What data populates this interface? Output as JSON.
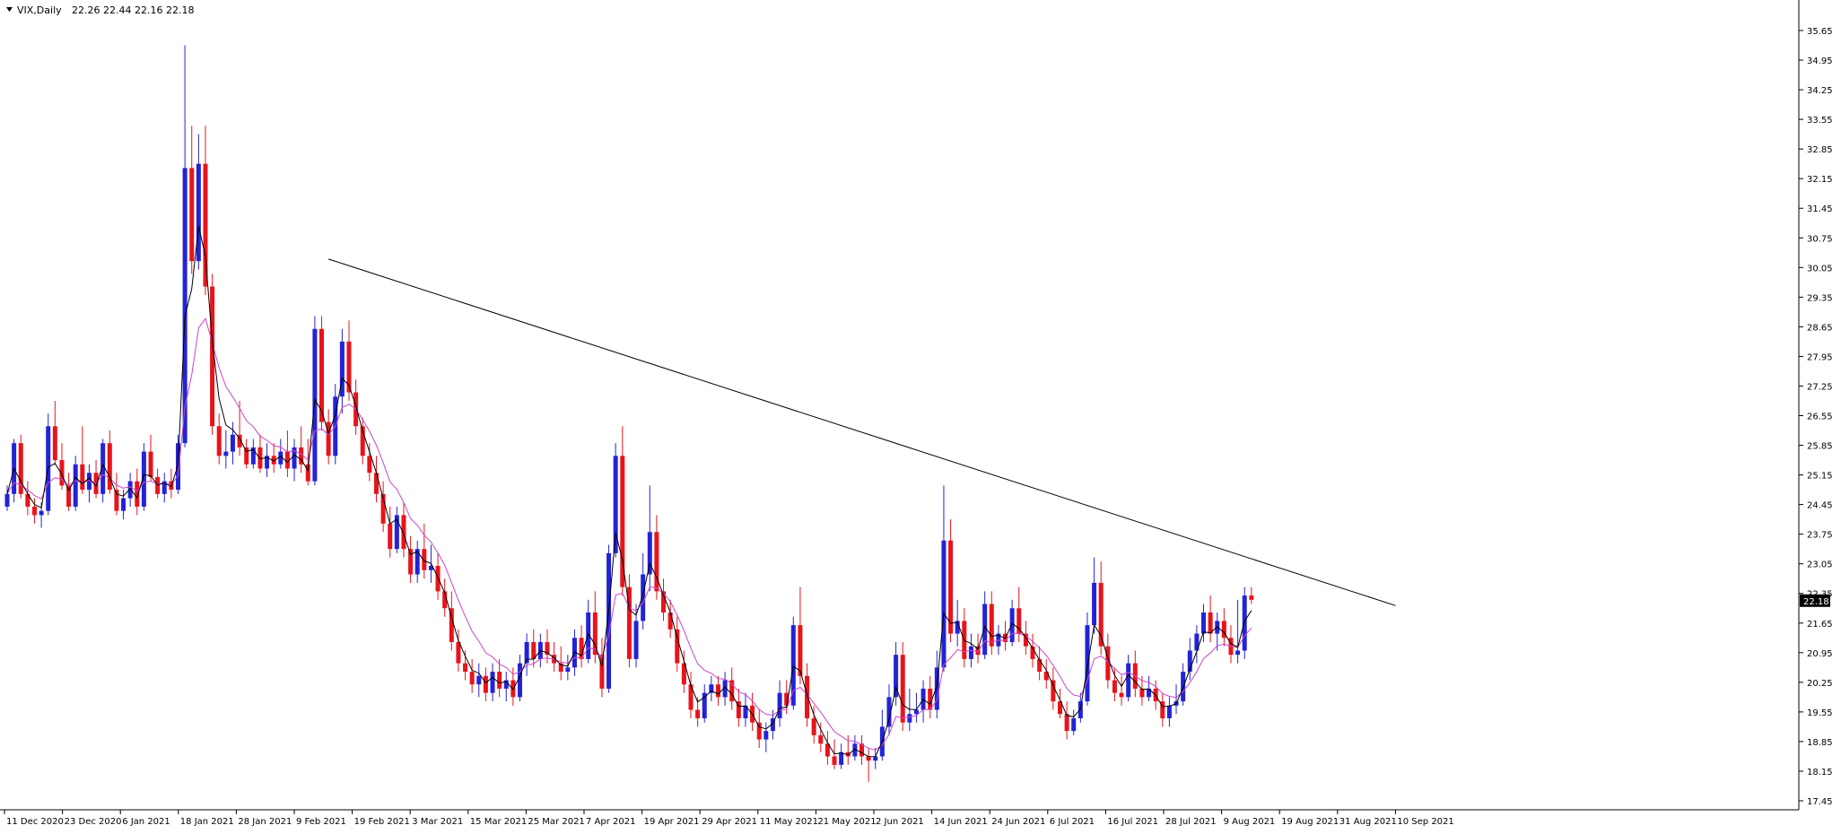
{
  "header": {
    "symbol_label": "VIX,Daily",
    "ohlc_readout": "22.26 22.44 22.16 22.18"
  },
  "colors": {
    "bull": "#2323d6",
    "bear": "#e8141b",
    "ma_fast": "#000000",
    "ma_slow": "#cc44cc",
    "trendline": "#000000",
    "axis": "#000000"
  },
  "chart_data": {
    "type": "candlestick",
    "x_tick_labels": [
      "11 Dec 2020",
      "23 Dec 2020",
      "6 Jan 2021",
      "18 Jan 2021",
      "28 Jan 2021",
      "9 Feb 2021",
      "19 Feb 2021",
      "3 Mar 2021",
      "15 Mar 2021",
      "25 Mar 2021",
      "7 Apr 2021",
      "19 Apr 2021",
      "29 Apr 2021",
      "11 May 2021",
      "21 May 2021",
      "2 Jun 2021",
      "14 Jun 2021",
      "24 Jun 2021",
      "6 Jul 2021",
      "16 Jul 2021",
      "28 Jul 2021",
      "9 Aug 2021",
      "19 Aug 2021",
      "31 Aug 2021",
      "10 Sep 2021"
    ],
    "y_tick_labels": [
      "35.65",
      "34.95",
      "34.25",
      "33.55",
      "32.85",
      "32.15",
      "31.45",
      "30.75",
      "30.05",
      "29.35",
      "28.65",
      "27.95",
      "27.25",
      "26.55",
      "25.85",
      "25.15",
      "24.45",
      "23.75",
      "23.05",
      "22.35",
      "21.65",
      "20.95",
      "20.25",
      "19.55",
      "18.85",
      "18.15",
      "17.45"
    ],
    "ylim": [
      17.45,
      35.65
    ],
    "current_price_label": "22.18",
    "candles": [
      [
        24.4,
        24.9,
        24.3,
        24.7
      ],
      [
        24.7,
        26.0,
        24.5,
        25.9
      ],
      [
        25.9,
        26.1,
        24.6,
        24.7
      ],
      [
        24.7,
        25.0,
        24.2,
        24.4
      ],
      [
        24.4,
        24.6,
        24.0,
        24.2
      ],
      [
        24.2,
        24.5,
        23.9,
        24.3
      ],
      [
        24.3,
        26.6,
        24.2,
        26.3
      ],
      [
        26.3,
        26.9,
        25.4,
        25.5
      ],
      [
        25.5,
        25.9,
        24.8,
        24.9
      ],
      [
        24.9,
        25.2,
        24.3,
        24.4
      ],
      [
        24.4,
        25.6,
        24.3,
        25.4
      ],
      [
        25.4,
        26.3,
        24.7,
        24.8
      ],
      [
        24.8,
        25.4,
        24.5,
        25.2
      ],
      [
        25.2,
        25.5,
        24.6,
        24.7
      ],
      [
        24.7,
        26.0,
        24.5,
        25.9
      ],
      [
        25.9,
        26.2,
        24.7,
        24.8
      ],
      [
        24.8,
        25.2,
        24.2,
        24.3
      ],
      [
        24.3,
        24.8,
        24.1,
        24.6
      ],
      [
        24.6,
        25.2,
        24.4,
        25.0
      ],
      [
        25.0,
        25.3,
        24.2,
        24.4
      ],
      [
        24.4,
        25.9,
        24.3,
        25.7
      ],
      [
        25.7,
        26.1,
        25.0,
        25.1
      ],
      [
        25.1,
        25.3,
        24.6,
        24.7
      ],
      [
        24.7,
        25.2,
        24.5,
        25.0
      ],
      [
        25.0,
        25.3,
        24.6,
        24.8
      ],
      [
        24.8,
        26.1,
        24.7,
        25.9
      ],
      [
        25.9,
        35.3,
        25.8,
        32.4
      ],
      [
        32.4,
        33.4,
        29.9,
        30.2
      ],
      [
        30.2,
        33.2,
        30.0,
        32.5
      ],
      [
        32.5,
        33.4,
        29.4,
        29.6
      ],
      [
        29.6,
        29.9,
        26.1,
        26.3
      ],
      [
        26.3,
        26.6,
        25.4,
        25.6
      ],
      [
        25.6,
        26.2,
        25.3,
        25.7
      ],
      [
        25.7,
        26.4,
        25.4,
        26.1
      ],
      [
        26.1,
        26.9,
        25.6,
        25.8
      ],
      [
        25.8,
        26.0,
        25.3,
        25.4
      ],
      [
        25.4,
        26.0,
        25.3,
        25.8
      ],
      [
        25.8,
        26.1,
        25.2,
        25.3
      ],
      [
        25.3,
        25.9,
        25.1,
        25.6
      ],
      [
        25.6,
        25.9,
        25.2,
        25.4
      ],
      [
        25.4,
        26.0,
        25.3,
        25.7
      ],
      [
        25.7,
        26.2,
        25.1,
        25.3
      ],
      [
        25.3,
        26.0,
        25.0,
        25.8
      ],
      [
        25.8,
        26.3,
        25.2,
        25.4
      ],
      [
        25.4,
        26.0,
        24.9,
        25.0
      ],
      [
        25.0,
        28.9,
        24.9,
        28.6
      ],
      [
        28.6,
        28.9,
        26.2,
        26.4
      ],
      [
        26.4,
        26.7,
        25.4,
        25.6
      ],
      [
        25.6,
        27.3,
        25.4,
        27.0
      ],
      [
        27.0,
        28.6,
        26.6,
        28.3
      ],
      [
        28.3,
        28.8,
        26.9,
        27.1
      ],
      [
        27.1,
        27.4,
        26.1,
        26.3
      ],
      [
        26.3,
        26.5,
        25.4,
        25.6
      ],
      [
        25.6,
        25.9,
        25.0,
        25.2
      ],
      [
        25.2,
        25.6,
        24.5,
        24.7
      ],
      [
        24.7,
        25.0,
        23.8,
        24.0
      ],
      [
        24.0,
        24.4,
        23.2,
        23.4
      ],
      [
        23.4,
        24.4,
        23.3,
        24.2
      ],
      [
        24.2,
        24.5,
        23.2,
        23.4
      ],
      [
        23.4,
        23.7,
        22.6,
        22.8
      ],
      [
        22.8,
        23.6,
        22.6,
        23.4
      ],
      [
        23.4,
        24.0,
        22.7,
        22.9
      ],
      [
        22.9,
        23.5,
        22.6,
        23.0
      ],
      [
        23.0,
        23.3,
        22.2,
        22.4
      ],
      [
        22.4,
        22.7,
        21.8,
        22.0
      ],
      [
        22.0,
        22.4,
        21.0,
        21.2
      ],
      [
        21.2,
        21.5,
        20.5,
        20.7
      ],
      [
        20.7,
        21.0,
        20.3,
        20.5
      ],
      [
        20.5,
        20.8,
        20.0,
        20.2
      ],
      [
        20.2,
        20.7,
        19.9,
        20.4
      ],
      [
        20.4,
        20.6,
        19.8,
        20.0
      ],
      [
        20.0,
        20.7,
        19.8,
        20.5
      ],
      [
        20.5,
        20.8,
        19.9,
        20.1
      ],
      [
        20.1,
        20.5,
        19.8,
        20.3
      ],
      [
        20.3,
        20.6,
        19.7,
        19.9
      ],
      [
        19.9,
        20.9,
        19.8,
        20.7
      ],
      [
        20.7,
        21.4,
        20.4,
        21.2
      ],
      [
        21.2,
        21.5,
        20.6,
        20.8
      ],
      [
        20.8,
        21.4,
        20.6,
        21.2
      ],
      [
        21.2,
        21.5,
        20.7,
        20.9
      ],
      [
        20.9,
        21.2,
        20.5,
        20.7
      ],
      [
        20.7,
        21.1,
        20.3,
        20.5
      ],
      [
        20.5,
        20.9,
        20.3,
        20.6
      ],
      [
        20.6,
        21.5,
        20.4,
        21.3
      ],
      [
        21.3,
        21.6,
        20.6,
        20.8
      ],
      [
        20.8,
        22.2,
        20.7,
        21.9
      ],
      [
        21.9,
        22.4,
        20.7,
        20.9
      ],
      [
        20.9,
        21.3,
        19.9,
        20.1
      ],
      [
        20.1,
        23.5,
        20.0,
        23.3
      ],
      [
        23.3,
        25.9,
        23.2,
        25.6
      ],
      [
        25.6,
        26.3,
        22.3,
        22.5
      ],
      [
        22.5,
        22.8,
        20.6,
        20.8
      ],
      [
        20.8,
        22.1,
        20.6,
        21.7
      ],
      [
        21.7,
        23.3,
        21.5,
        22.8
      ],
      [
        22.8,
        24.9,
        22.4,
        23.8
      ],
      [
        23.8,
        24.2,
        22.2,
        22.4
      ],
      [
        22.4,
        22.7,
        21.7,
        21.9
      ],
      [
        21.9,
        22.2,
        21.3,
        21.5
      ],
      [
        21.5,
        21.8,
        20.5,
        20.7
      ],
      [
        20.7,
        21.0,
        20.0,
        20.2
      ],
      [
        20.2,
        20.5,
        19.4,
        19.6
      ],
      [
        19.6,
        19.9,
        19.2,
        19.4
      ],
      [
        19.4,
        20.2,
        19.3,
        20.0
      ],
      [
        20.0,
        20.4,
        19.8,
        20.2
      ],
      [
        20.2,
        20.4,
        19.7,
        19.9
      ],
      [
        19.9,
        20.5,
        19.7,
        20.3
      ],
      [
        20.3,
        20.6,
        19.6,
        19.8
      ],
      [
        19.8,
        20.1,
        19.2,
        19.4
      ],
      [
        19.4,
        20.0,
        19.2,
        19.7
      ],
      [
        19.7,
        20.0,
        19.1,
        19.3
      ],
      [
        19.3,
        19.6,
        18.7,
        18.9
      ],
      [
        18.9,
        19.3,
        18.6,
        19.1
      ],
      [
        19.1,
        19.6,
        18.9,
        19.4
      ],
      [
        19.4,
        20.3,
        19.2,
        20.0
      ],
      [
        20.0,
        20.3,
        19.5,
        19.7
      ],
      [
        19.7,
        21.8,
        19.6,
        21.6
      ],
      [
        21.6,
        22.5,
        20.2,
        20.4
      ],
      [
        20.4,
        20.7,
        19.2,
        19.4
      ],
      [
        19.4,
        19.7,
        18.8,
        19.0
      ],
      [
        19.0,
        19.3,
        18.6,
        18.8
      ],
      [
        18.8,
        19.1,
        18.3,
        18.5
      ],
      [
        18.5,
        18.9,
        18.2,
        18.3
      ],
      [
        18.3,
        18.8,
        18.2,
        18.6
      ],
      [
        18.6,
        19.0,
        18.3,
        18.5
      ],
      [
        18.5,
        19.0,
        18.4,
        18.8
      ],
      [
        18.8,
        19.0,
        18.3,
        18.5
      ],
      [
        18.5,
        18.7,
        17.9,
        18.4
      ],
      [
        18.4,
        18.7,
        18.2,
        18.5
      ],
      [
        18.5,
        19.6,
        18.4,
        19.2
      ],
      [
        19.2,
        20.2,
        19.0,
        19.9
      ],
      [
        19.9,
        21.2,
        19.7,
        20.9
      ],
      [
        20.9,
        21.2,
        19.1,
        19.3
      ],
      [
        19.3,
        20.1,
        19.1,
        19.5
      ],
      [
        19.5,
        20.0,
        19.3,
        19.6
      ],
      [
        19.6,
        20.3,
        19.3,
        20.1
      ],
      [
        20.1,
        20.4,
        19.4,
        19.6
      ],
      [
        19.6,
        21.0,
        19.4,
        20.6
      ],
      [
        20.6,
        24.9,
        20.5,
        23.6
      ],
      [
        23.6,
        24.1,
        21.2,
        21.4
      ],
      [
        21.4,
        22.2,
        21.1,
        21.7
      ],
      [
        21.7,
        22.0,
        20.6,
        20.8
      ],
      [
        20.8,
        21.4,
        20.6,
        21.1
      ],
      [
        21.1,
        21.4,
        20.7,
        20.9
      ],
      [
        20.9,
        22.4,
        20.8,
        22.1
      ],
      [
        22.1,
        22.4,
        20.9,
        21.1
      ],
      [
        21.1,
        21.6,
        20.9,
        21.4
      ],
      [
        21.4,
        21.7,
        21.0,
        21.2
      ],
      [
        21.2,
        22.2,
        21.1,
        22.0
      ],
      [
        22.0,
        22.5,
        21.2,
        21.4
      ],
      [
        21.4,
        21.7,
        20.9,
        21.1
      ],
      [
        21.1,
        21.4,
        20.6,
        20.8
      ],
      [
        20.8,
        21.1,
        20.3,
        20.5
      ],
      [
        20.5,
        20.8,
        20.1,
        20.3
      ],
      [
        20.3,
        20.6,
        19.6,
        19.8
      ],
      [
        19.8,
        20.1,
        19.4,
        19.5
      ],
      [
        19.5,
        19.8,
        18.9,
        19.1
      ],
      [
        19.1,
        19.6,
        19.0,
        19.4
      ],
      [
        19.4,
        20.0,
        19.3,
        19.8
      ],
      [
        19.8,
        21.9,
        19.7,
        21.6
      ],
      [
        21.6,
        23.2,
        21.4,
        22.6
      ],
      [
        22.6,
        23.1,
        20.9,
        21.1
      ],
      [
        21.1,
        21.4,
        20.1,
        20.3
      ],
      [
        20.3,
        20.6,
        19.8,
        20.0
      ],
      [
        20.0,
        20.4,
        19.7,
        19.9
      ],
      [
        19.9,
        20.9,
        19.8,
        20.7
      ],
      [
        20.7,
        21.0,
        19.9,
        20.1
      ],
      [
        20.1,
        20.4,
        19.7,
        19.9
      ],
      [
        19.9,
        20.4,
        19.8,
        20.1
      ],
      [
        20.1,
        20.3,
        19.6,
        19.8
      ],
      [
        19.8,
        20.0,
        19.2,
        19.4
      ],
      [
        19.4,
        19.9,
        19.2,
        19.7
      ],
      [
        19.7,
        20.2,
        19.5,
        19.8
      ],
      [
        19.8,
        20.7,
        19.7,
        20.5
      ],
      [
        20.5,
        21.3,
        20.3,
        21.0
      ],
      [
        21.0,
        21.6,
        20.7,
        21.4
      ],
      [
        21.4,
        22.1,
        21.2,
        21.9
      ],
      [
        21.9,
        22.3,
        21.2,
        21.4
      ],
      [
        21.4,
        21.9,
        21.0,
        21.7
      ],
      [
        21.7,
        22.0,
        21.1,
        21.3
      ],
      [
        21.3,
        21.6,
        20.7,
        20.9
      ],
      [
        20.9,
        22.2,
        20.7,
        21.0
      ],
      [
        21.0,
        22.5,
        20.8,
        22.3
      ],
      [
        22.3,
        22.5,
        22.1,
        22.2
      ]
    ],
    "moving_averages": [
      {
        "period_label": "",
        "smoothing": 3
      },
      {
        "period_label": "",
        "smoothing": 8
      }
    ],
    "trendline": {
      "start": {
        "bar_index": 47,
        "price": 30.25
      },
      "end": {
        "bar_index": 188,
        "price": 21.55
      }
    }
  }
}
